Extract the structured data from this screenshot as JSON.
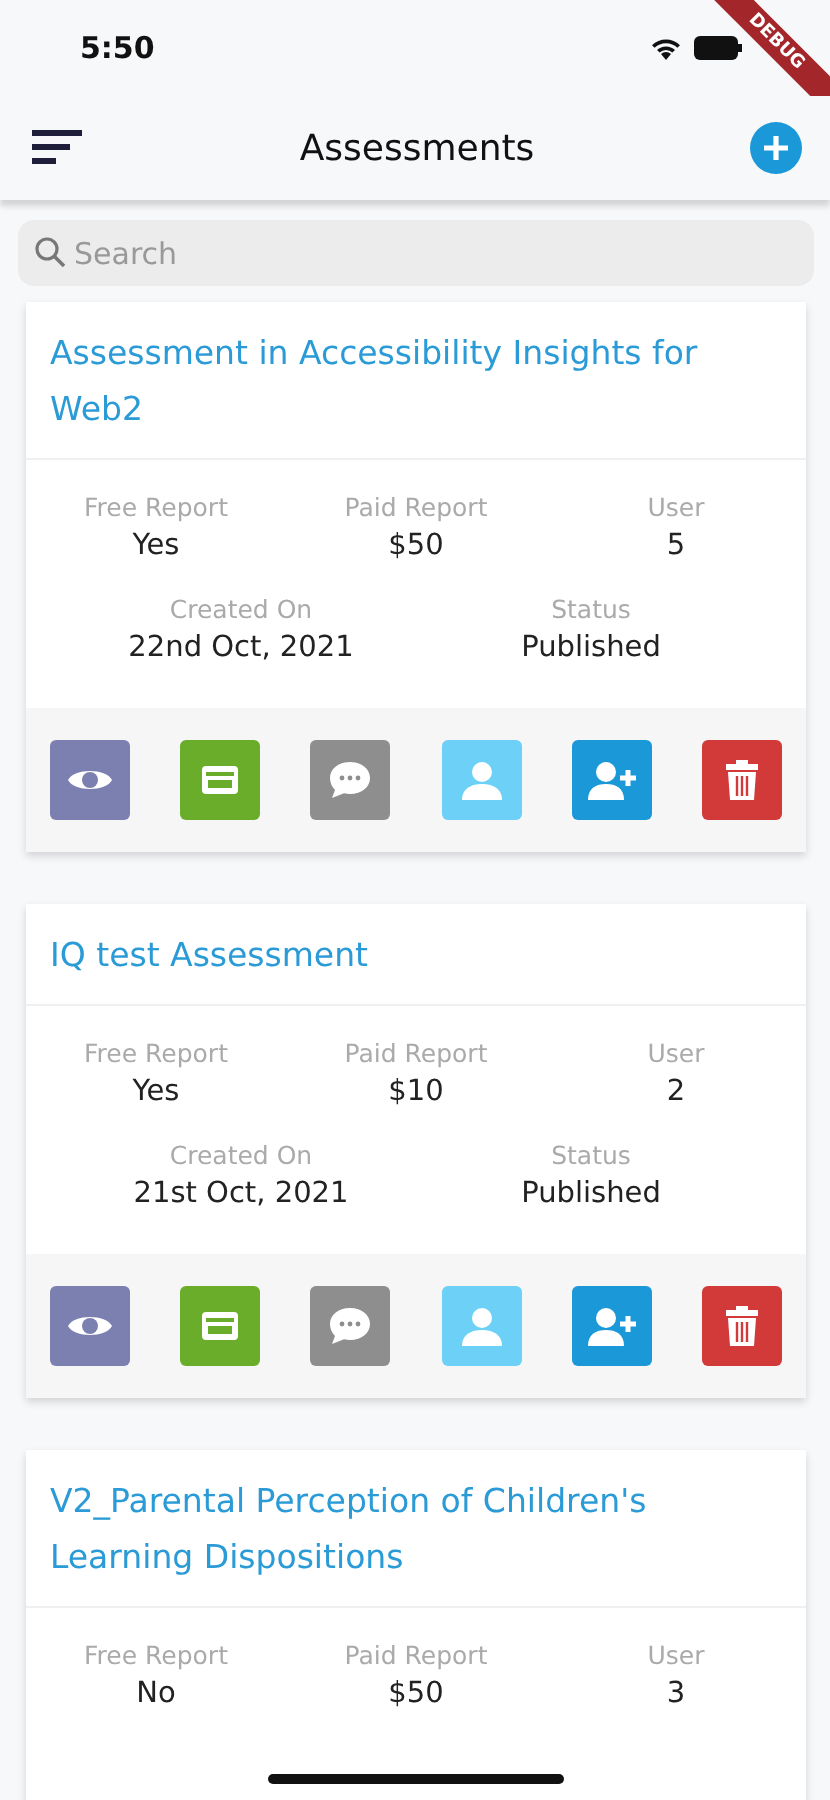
{
  "status_bar": {
    "time": "5:50"
  },
  "debug_banner": "DEBUG",
  "app_bar": {
    "title": "Assessments"
  },
  "search": {
    "placeholder": "Search"
  },
  "actions": [
    {
      "kind": "view"
    },
    {
      "kind": "report"
    },
    {
      "kind": "comment"
    },
    {
      "kind": "user"
    },
    {
      "kind": "add-user"
    },
    {
      "kind": "delete"
    }
  ],
  "assessments": [
    {
      "title": "Assessment in Accessibility Insights for Web2",
      "stats": [
        {
          "label": "Free Report",
          "value": "Yes"
        },
        {
          "label": "Paid Report",
          "value": "$50"
        },
        {
          "label": "User",
          "value": "5"
        }
      ],
      "details": [
        {
          "label": "Created On",
          "value": "22nd Oct, 2021"
        },
        {
          "label": "Status",
          "value": "Published"
        }
      ]
    },
    {
      "title": "IQ test Assessment",
      "stats": [
        {
          "label": "Free Report",
          "value": "Yes"
        },
        {
          "label": "Paid Report",
          "value": "$10"
        },
        {
          "label": "User",
          "value": "2"
        }
      ],
      "details": [
        {
          "label": "Created On",
          "value": "21st Oct, 2021"
        },
        {
          "label": "Status",
          "value": "Published"
        }
      ]
    },
    {
      "title": "V2_Parental Perception of Children's Learning Dispositions",
      "stats": [
        {
          "label": "Free Report",
          "value": "No"
        },
        {
          "label": "Paid Report",
          "value": "$50"
        },
        {
          "label": "User",
          "value": "3"
        }
      ]
    }
  ]
}
